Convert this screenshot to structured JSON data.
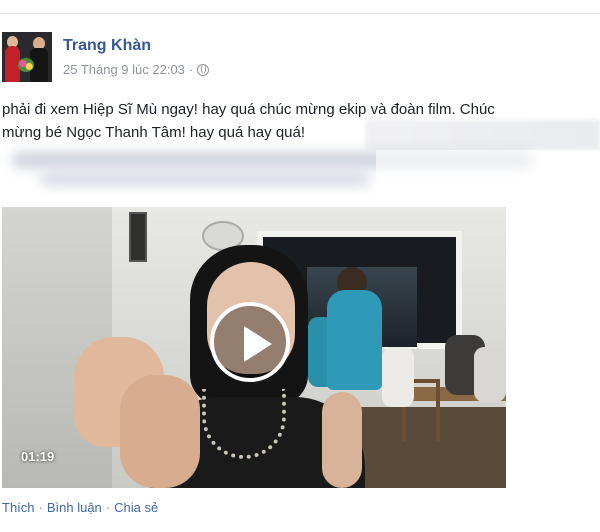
{
  "post": {
    "author": "Trang Khàn",
    "timestamp": "25 Tháng 9 lúc 22:03",
    "separator": "·",
    "privacy_icon": "globe-icon",
    "text_line1": "phải đi xem Hiệp Sĩ Mù ngay! hay quá chúc mừng ekip và đoàn film. Chúc",
    "text_line2": "mừng bé Ngọc Thanh Tâm! hay quá hay quá!"
  },
  "video": {
    "duration": "01:19",
    "play_icon": "play-icon"
  },
  "actions": {
    "like": "Thích",
    "comment": "Bình luận",
    "share": "Chia sẻ",
    "separator": "·"
  },
  "colors": {
    "link": "#365899",
    "meta": "#90949c",
    "action_link": "#4267b2"
  }
}
